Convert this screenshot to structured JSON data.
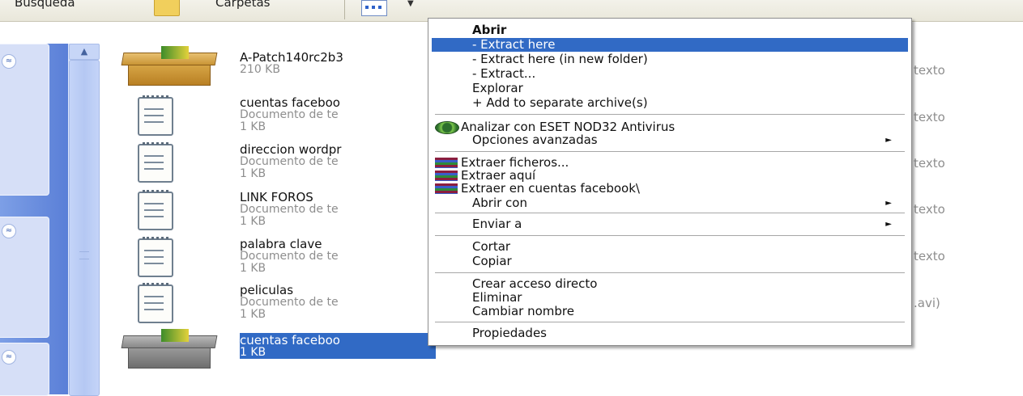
{
  "toolbar": {
    "search_label": "Búsqueda",
    "folders_label": "Carpetas"
  },
  "files": [
    {
      "name": "A-Patch140rc2b3",
      "type": "",
      "size": "210 KB",
      "kind": "archive"
    },
    {
      "name": "cuentas faceboo",
      "type": "Documento de te",
      "size": "1 KB",
      "kind": "text"
    },
    {
      "name": "direccion wordpr",
      "type": "Documento de te",
      "size": "1 KB",
      "kind": "text"
    },
    {
      "name": "LINK FOROS",
      "type": "Documento de te",
      "size": "1 KB",
      "kind": "text"
    },
    {
      "name": "palabra clave",
      "type": "Documento de te",
      "size": "1 KB",
      "kind": "text"
    },
    {
      "name": "peliculas",
      "type": "Documento de te",
      "size": "1 KB",
      "kind": "text"
    },
    {
      "name": "cuentas faceboo",
      "type": "",
      "size": "1 KB",
      "kind": "archive-selected"
    }
  ],
  "right_column": [
    "texto",
    "texto",
    "texto",
    "texto",
    "texto",
    ".avi)"
  ],
  "context_menu": {
    "items": [
      {
        "label": "Abrir",
        "bold": true
      },
      {
        "label": "- Extract here",
        "highlighted": true
      },
      {
        "label": "- Extract here (in new folder)"
      },
      {
        "label": "- Extract..."
      },
      {
        "label": "Explorar"
      },
      {
        "label": "+ Add to separate archive(s)"
      },
      {
        "label": "Analizar con ESET NOD32 Antivirus",
        "icon": "eset-icon"
      },
      {
        "label": "Opciones avanzadas",
        "submenu": true
      },
      {
        "label": "Extraer ficheros...",
        "icon": "winrar-icon"
      },
      {
        "label": "Extraer aquí",
        "icon": "winrar-icon"
      },
      {
        "label": "Extraer en cuentas facebook\\",
        "icon": "winrar-icon"
      },
      {
        "label": "Abrir con",
        "submenu": true
      },
      {
        "label": "Enviar a",
        "submenu": true
      },
      {
        "label": "Cortar"
      },
      {
        "label": "Copiar"
      },
      {
        "label": "Crear acceso directo"
      },
      {
        "label": "Eliminar"
      },
      {
        "label": "Cambiar nombre"
      },
      {
        "label": "Propiedades"
      }
    ],
    "submenu_arrow": "►"
  },
  "colors": {
    "selection": "#316ac5",
    "task_pane": "#6b8fdf"
  }
}
